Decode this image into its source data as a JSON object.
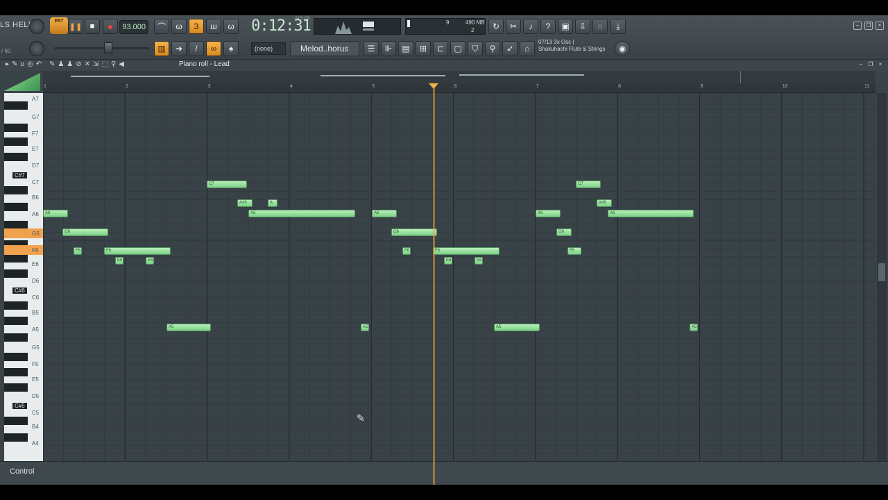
{
  "menu": {
    "help_label": "LS HELP"
  },
  "transport": {
    "pat_label": "PAT",
    "play_label": "❚❚",
    "stop_label": "■",
    "rec_label": "●",
    "tempo": "93.000",
    "time": "0:12:31",
    "time_unit": "M:S:CS"
  },
  "system": {
    "ram": "490 MB",
    "cpu_lines": [
      "9",
      "2"
    ]
  },
  "toolbar2": {
    "pat_count": "/ 60",
    "snap": "(none)",
    "pattern_name": "Melod..horus",
    "hint_line1": "07/13  3x Osc |",
    "hint_line2": "Shakuhachi Flute & Strings"
  },
  "pianoroll": {
    "title": "Piano roll - Lead",
    "control_label": "Control",
    "bars": [
      "1",
      "2",
      "3",
      "4",
      "5",
      "6",
      "7",
      "8",
      "9",
      "10",
      "11"
    ],
    "keys": [
      "A7",
      "G7",
      "F7",
      "E7",
      "D7",
      "C#7",
      "C7",
      "B6",
      "A6",
      "G6",
      "F6",
      "E6",
      "D6",
      "C#6",
      "C6",
      "B5",
      "A5",
      "G5",
      "F5",
      "E5",
      "D5",
      "C#5",
      "C5",
      "B4",
      "A4"
    ],
    "highlighted_keys": [
      "G6",
      "F6"
    ],
    "notes": [
      {
        "label": "A6",
        "pitch": "A6"
      },
      {
        "label": "G6",
        "pitch": "G6"
      },
      {
        "label": "F6",
        "pitch": "F6"
      },
      {
        "label": "F6",
        "pitch": "F6"
      },
      {
        "label": "E6",
        "pitch": "E6"
      },
      {
        "label": "E6",
        "pitch": "E6"
      },
      {
        "label": "A5",
        "pitch": "A5"
      },
      {
        "label": "C7",
        "pitch": "C7"
      },
      {
        "label": "A#6",
        "pitch": "A#6"
      },
      {
        "label": "A",
        "pitch": "A#6"
      },
      {
        "label": "A6",
        "pitch": "A6"
      },
      {
        "label": "A5",
        "pitch": "A5"
      },
      {
        "label": "A6",
        "pitch": "A6"
      },
      {
        "label": "G6",
        "pitch": "G6"
      },
      {
        "label": "F6",
        "pitch": "F6"
      },
      {
        "label": "F6",
        "pitch": "F6"
      },
      {
        "label": "E6",
        "pitch": "E6"
      },
      {
        "label": "E6",
        "pitch": "E6"
      },
      {
        "label": "A5",
        "pitch": "A5"
      },
      {
        "label": "A6",
        "pitch": "A6"
      },
      {
        "label": "G6",
        "pitch": "G6"
      },
      {
        "label": "F6",
        "pitch": "F6"
      },
      {
        "label": "C7",
        "pitch": "C7"
      },
      {
        "label": "A#6",
        "pitch": "A#6"
      },
      {
        "label": "A6",
        "pitch": "A6"
      },
      {
        "label": "A5",
        "pitch": "A5"
      }
    ]
  },
  "colors": {
    "note_fill": "#a6e6ab",
    "playhead": "#f0a040",
    "accent": "#f3b043"
  }
}
